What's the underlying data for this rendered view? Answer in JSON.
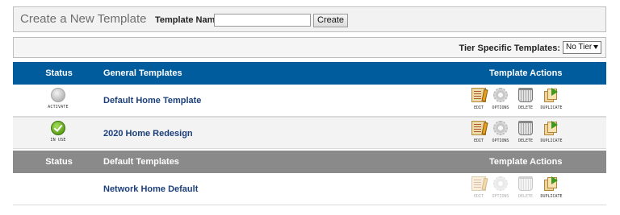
{
  "create": {
    "title": "Create a New Template",
    "name_label": "Template Name:",
    "name_value": "",
    "name_placeholder": "",
    "create_button": "Create"
  },
  "tier": {
    "label": "Tier Specific Templates:",
    "selected": "No Tier"
  },
  "general_header": {
    "status": "Status",
    "name": "General Templates",
    "actions": "Template Actions"
  },
  "default_header": {
    "status": "Status",
    "name": "Default Templates",
    "actions": "Template Actions"
  },
  "action_labels": {
    "edit": "EDIT",
    "options": "OPTIONS",
    "delete": "DELETE",
    "duplicate": "DUPLICATE"
  },
  "rows": [
    {
      "name": "Default Home Template",
      "status": "ACTIVATE",
      "status_icon": "gray-circle-icon"
    },
    {
      "name": "2020 Home Redesign",
      "status": "IN USE",
      "status_icon": "green-check-icon"
    },
    {
      "name": "Network Home Default",
      "status": "",
      "disabled_actions": [
        "EDIT",
        "OPTIONS",
        "DELETE"
      ]
    }
  ],
  "colors": {
    "general_header_bg": "#005c9d",
    "default_header_bg": "#8a8a8a",
    "link": "#1c3f7a",
    "in_use_green": "#5ea01c"
  }
}
